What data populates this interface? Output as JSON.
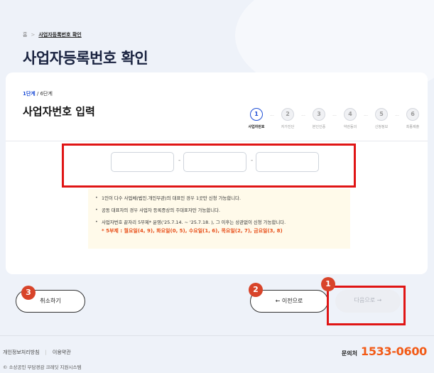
{
  "breadcrumb": {
    "home": "홈",
    "separator": ">",
    "current": "사업자등록번호 확인"
  },
  "page_title": "사업자등록번호 확인",
  "step_info": {
    "current": "1단계",
    "total": " / 6단계"
  },
  "section_title": "사업자번호 입력",
  "steps": [
    {
      "num": "1",
      "label": "사업자번호"
    },
    {
      "num": "2",
      "label": "자가진단"
    },
    {
      "num": "3",
      "label": "본인인증"
    },
    {
      "num": "4",
      "label": "약관동의"
    },
    {
      "num": "5",
      "label": "신청정보"
    },
    {
      "num": "6",
      "label": "최종제출"
    }
  ],
  "step_dots": "···",
  "inputs": {
    "part1": "",
    "part2": "",
    "part3": "",
    "dash": "-"
  },
  "notices": [
    "1인이 다수 사업체(법인.개인무관)의 대표인 경우 1곳만 신청 가능합니다.",
    "공동 대표자의 경우 사업자 등록증상의 주대표자만 가능합니다.",
    "사업자번호 끝자리 5부제* 운영('25.7.14. ~ '25.7.18. ), 그 이후는 상관없이 신청 가능합니다."
  ],
  "notice_red": "* 5부제 : 월요일(4, 9), 화요일(0, 5), 수요일(1, 6), 목요일(2, 7), 금요일(3, 8)",
  "buttons": {
    "cancel": "취소하기",
    "prev": "← 이전으로",
    "next": "다음으로 →"
  },
  "badges": {
    "one": "1",
    "two": "2",
    "three": "3"
  },
  "footer": {
    "privacy": "개인정보처리방침",
    "divider": "|",
    "terms": "이용약관",
    "copyright": "© 소상공인 부담경감 크레딧 지원시스템",
    "contact_label": "문의처",
    "contact_number": "1533-0600"
  },
  "colors": {
    "primary": "#1f4fd6",
    "accent": "#f25a16",
    "annotation": "#e01515",
    "badge": "#d8442a"
  }
}
